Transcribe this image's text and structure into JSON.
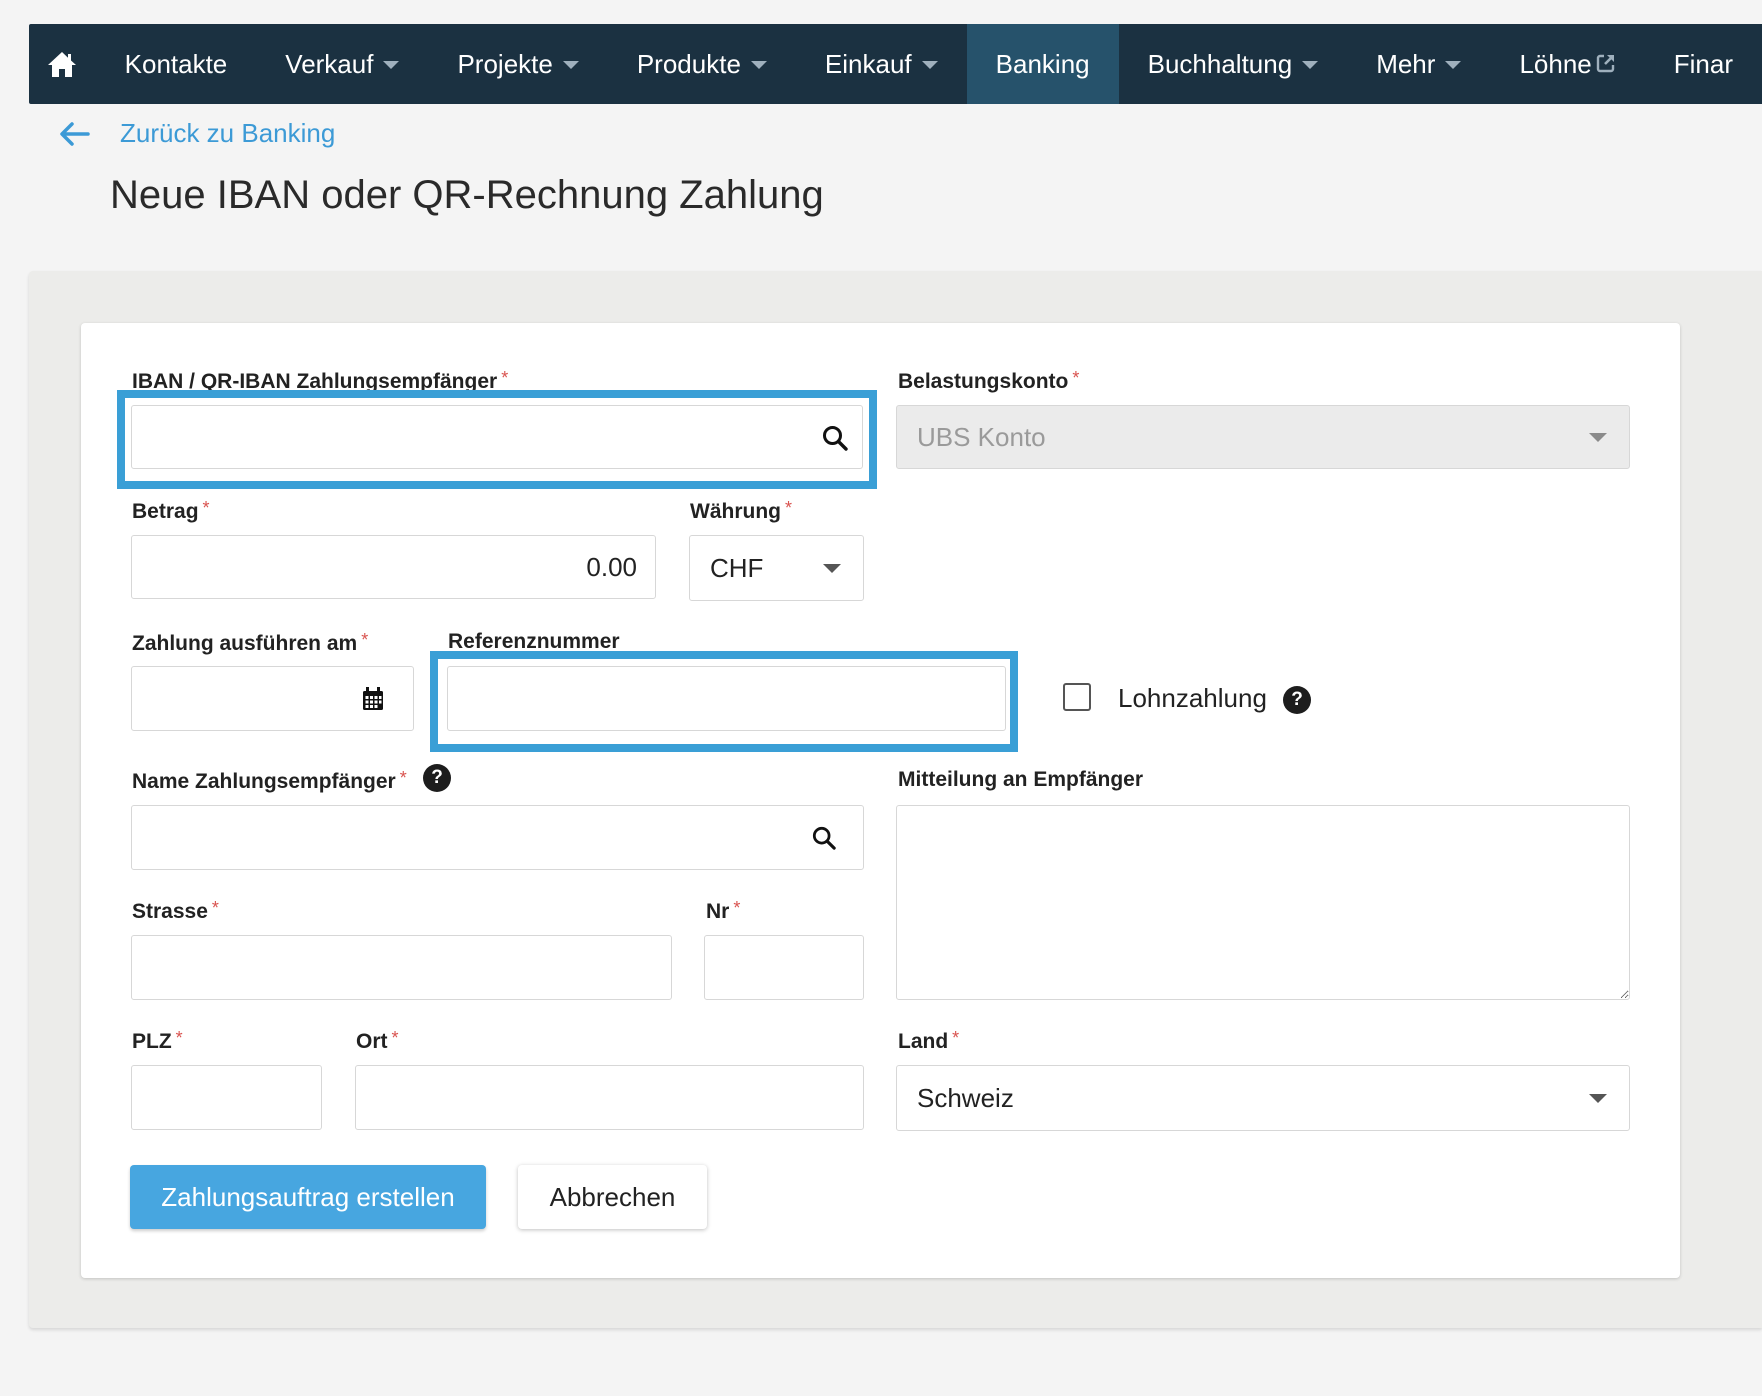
{
  "nav": {
    "items": [
      {
        "label": "Kontakte",
        "dropdown": false
      },
      {
        "label": "Verkauf",
        "dropdown": true
      },
      {
        "label": "Projekte",
        "dropdown": true
      },
      {
        "label": "Produkte",
        "dropdown": true
      },
      {
        "label": "Einkauf",
        "dropdown": true
      },
      {
        "label": "Banking",
        "dropdown": false,
        "active": true
      },
      {
        "label": "Buchhaltung",
        "dropdown": true
      },
      {
        "label": "Mehr",
        "dropdown": true
      },
      {
        "label": "Löhne",
        "external": true
      },
      {
        "label": "Finar"
      }
    ]
  },
  "back_link": "Zurück zu Banking",
  "page_title": "Neue IBAN oder QR-Rechnung Zahlung",
  "form": {
    "iban_label": "IBAN / QR-IBAN Zahlungsempfänger",
    "iban_value": "",
    "belastungskonto_label": "Belastungskonto",
    "belastungskonto_value": "UBS Konto",
    "betrag_label": "Betrag",
    "betrag_value": "0.00",
    "waehrung_label": "Währung",
    "waehrung_value": "CHF",
    "datum_label": "Zahlung ausführen am",
    "referenz_label": "Referenznummer",
    "lohnzahlung_label": "Lohnzahlung",
    "name_label": "Name Zahlungsempfänger",
    "mitteilung_label": "Mitteilung an Empfänger",
    "strasse_label": "Strasse",
    "nr_label": "Nr",
    "plz_label": "PLZ",
    "ort_label": "Ort",
    "land_label": "Land",
    "land_value": "Schweiz",
    "required_marker": "*",
    "help_glyph": "?"
  },
  "buttons": {
    "submit": "Zahlungsauftrag erstellen",
    "cancel": "Abbrechen"
  },
  "colors": {
    "nav_bg": "#1b3141",
    "nav_active": "#26526b",
    "accent": "#3a9fd6",
    "primary_button": "#47a6e0",
    "required": "#d9534f"
  }
}
